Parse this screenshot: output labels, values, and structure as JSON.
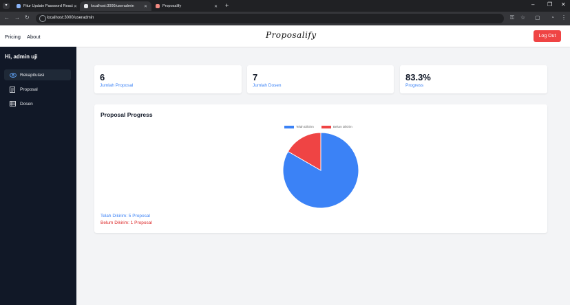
{
  "browser": {
    "tabs": [
      {
        "title": "Fitur Update Password React",
        "active": false,
        "favicon_color": "#8ab4f8"
      },
      {
        "title": "localhost:3000/useradmin",
        "active": true,
        "favicon_color": "#e8eaed"
      },
      {
        "title": "Proposalify",
        "active": false,
        "favicon_color": "#f28b82"
      }
    ],
    "url": "localhost:3000/useradmin"
  },
  "nav": {
    "links": [
      "Pricing",
      "About"
    ],
    "logo": "Proposalify",
    "logout_label": "Log Out"
  },
  "sidebar": {
    "greeting": "Hi, admin uji",
    "items": [
      {
        "label": "Rekapitulasi",
        "icon": "eye-icon",
        "active": true
      },
      {
        "label": "Proposal",
        "icon": "document-icon",
        "active": false
      },
      {
        "label": "Dosen",
        "icon": "list-icon",
        "active": false
      }
    ]
  },
  "stats": [
    {
      "value": "6",
      "label": "Jumlah Proposal"
    },
    {
      "value": "7",
      "label": "Jumlah Dosen"
    },
    {
      "value": "83.3%",
      "label": "Progress"
    }
  ],
  "progress": {
    "title": "Proposal Progress",
    "summary_sent": "Telah Dikirim: 5 Proposal",
    "summary_unsent": "Belum Dikirim: 1 Proposal"
  },
  "chart_data": {
    "type": "pie",
    "categories": [
      "Telah Dikirim",
      "Belum Dikirim"
    ],
    "values": [
      5,
      1
    ],
    "colors": [
      "#3b82f6",
      "#ef4444"
    ],
    "legend": "top"
  }
}
